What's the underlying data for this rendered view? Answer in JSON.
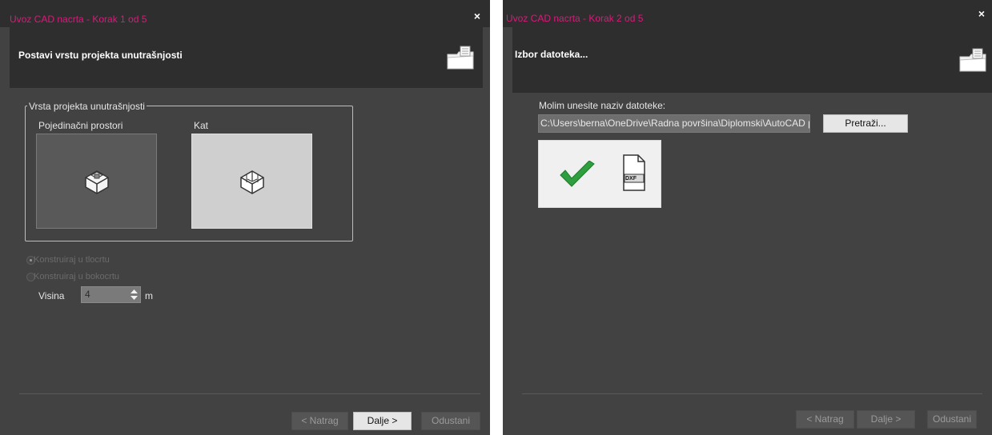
{
  "dialog1": {
    "title": "Uvoz CAD nacrta - Korak 1 od 5",
    "close": "×",
    "header_title": "Postavi vrstu projekta unutrašnjosti",
    "header_icon": "folder-import-icon",
    "group_label": "Vrsta projekta unutrašnjosti",
    "options": [
      {
        "label": "Pojedinačni prostori",
        "icon": "single-room-icon",
        "selected": true
      },
      {
        "label": "Kat",
        "icon": "floor-rooms-icon",
        "selected": false
      }
    ],
    "radios": [
      {
        "label": "Konstruiraj u tlocrtu",
        "checked": true
      },
      {
        "label": "Konstruiraj u bokocrtu",
        "checked": false
      }
    ],
    "height_label": "Visina",
    "height_value": "4",
    "height_unit": "m",
    "buttons": {
      "back": "< Natrag",
      "next": "Dalje >",
      "cancel": "Odustani"
    }
  },
  "dialog2": {
    "title": "Uvoz CAD nacrta - Korak 2 od 5",
    "close": "×",
    "header_title": "Izbor datoteka...",
    "header_icon": "folder-import-icon",
    "prompt": "Molim unesite naziv datoteke:",
    "file_path": "C:\\Users\\berna\\OneDrive\\Radna površina\\Diplomski\\AutoCAD postojeće",
    "browse": "Pretraži...",
    "status_icon": "green-checkmark-icon",
    "file_type_label": "DXF",
    "buttons": {
      "back": "< Natrag",
      "next": "Dalje >",
      "cancel": "Odustani"
    }
  },
  "colors": {
    "title_accent": "#d81b7a",
    "panel_bg": "#424242",
    "header_bg": "#2e2e2e",
    "check_green": "#2e9e3e"
  }
}
